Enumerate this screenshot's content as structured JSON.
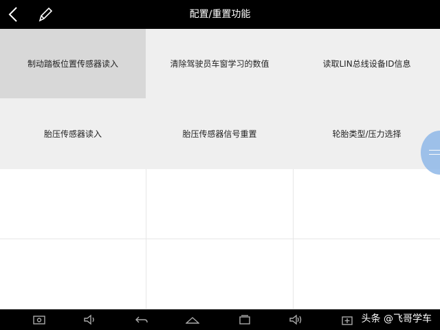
{
  "header": {
    "title": "配置/重置功能",
    "back_icon": "chevron-left-icon",
    "edit_icon": "pencil-icon"
  },
  "functions": [
    {
      "label": "制动踏板位置传感器读入"
    },
    {
      "label": "清除驾驶员车窗学习的数值"
    },
    {
      "label": "读取LIN总线设备ID信息"
    },
    {
      "label": "胎压传感器读入"
    },
    {
      "label": "胎压传感器信号重置"
    },
    {
      "label": "轮胎类型/压力选择"
    }
  ],
  "navbar": {
    "icons": [
      "screenshot-icon",
      "volume-down-icon",
      "back-icon",
      "home-icon",
      "recents-icon",
      "volume-up-icon",
      "add-window-icon"
    ]
  },
  "watermark": "头条 @飞哥学车",
  "colors": {
    "topbar_bg": "#000000",
    "cell_bg": "#efefef",
    "cell_selected_bg": "#d8d8d8",
    "float_button": "#8fb8e8"
  }
}
